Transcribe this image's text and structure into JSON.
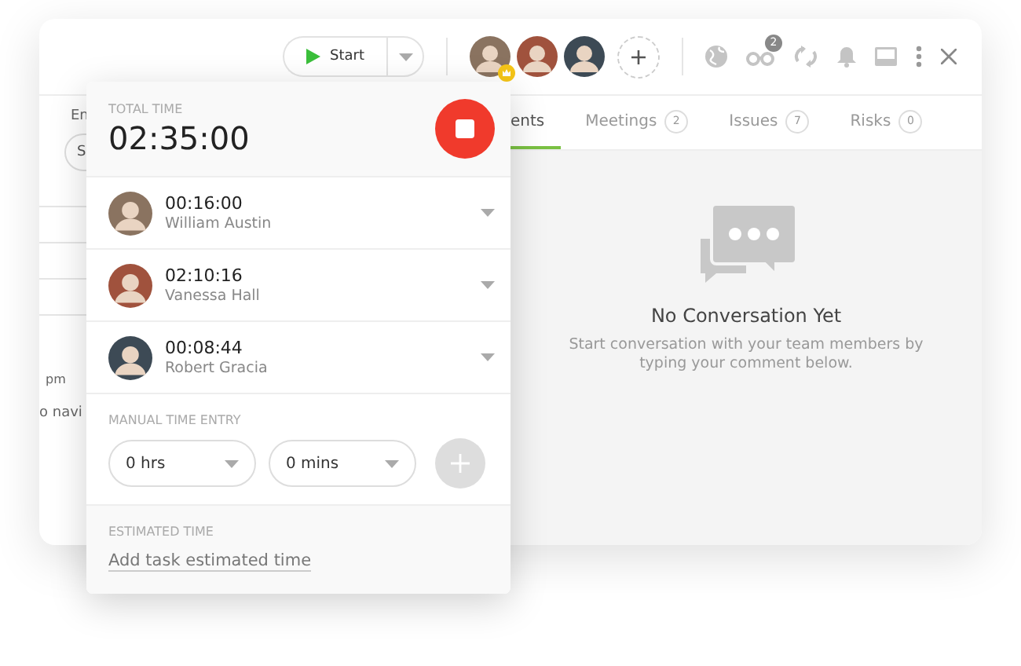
{
  "header": {
    "start_button": "Start",
    "members": [
      {
        "owner": true
      },
      {
        "owner": false
      },
      {
        "owner": false
      }
    ],
    "watch_count": "2"
  },
  "left_column": {
    "label": "En",
    "pill": "S",
    "time": "pm",
    "hint": "o navi"
  },
  "tabs": [
    {
      "label": "ents",
      "selected": true
    },
    {
      "label": "Meetings",
      "count": "2",
      "selected": false
    },
    {
      "label": "Issues",
      "count": "7",
      "selected": false
    },
    {
      "label": "Risks",
      "count": "0",
      "selected": false
    }
  ],
  "empty_state": {
    "title": "No Conversation Yet",
    "text": "Start conversation with your team members by typing your comment below."
  },
  "timer": {
    "total_label": "TOTAL TIME",
    "total": "02:35:00",
    "running": true,
    "entries": [
      {
        "time": "00:16:00",
        "name": "William Austin"
      },
      {
        "time": "02:10:16",
        "name": "Vanessa Hall"
      },
      {
        "time": "00:08:44",
        "name": "Robert Gracia"
      }
    ],
    "manual": {
      "label": "MANUAL TIME ENTRY",
      "hours": "0 hrs",
      "minutes": "0 mins"
    },
    "estimated": {
      "label": "ESTIMATED TIME",
      "link": "Add task estimated time"
    }
  }
}
